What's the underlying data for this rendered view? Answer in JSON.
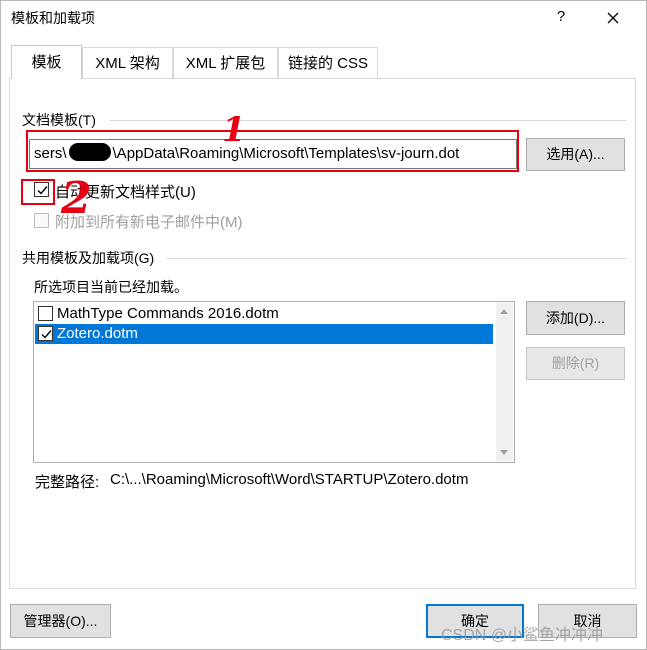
{
  "window": {
    "title": "模板和加载项",
    "help_label": "?"
  },
  "tabs": [
    {
      "label": "模板",
      "active": true
    },
    {
      "label": "XML 架构",
      "active": false
    },
    {
      "label": "XML 扩展包",
      "active": false
    },
    {
      "label": "链接的 CSS",
      "active": false
    }
  ],
  "document_template": {
    "group_label": "文档模板(T)",
    "path_prefix": "sers\\",
    "path_suffix": "\\AppData\\Roaming\\Microsoft\\Templates\\sv-journ.dot",
    "attach_button": "选用(A)...",
    "auto_update": {
      "label": "自动更新文档样式(U)",
      "checked": true
    },
    "attach_email": {
      "label": "附加到所有新电子邮件中(M)",
      "checked": false,
      "disabled": true
    }
  },
  "global_templates": {
    "group_label": "共用模板及加载项(G)",
    "subtitle": "所选项目当前已经加载。",
    "items": [
      {
        "label": "MathType Commands 2016.dotm",
        "checked": false,
        "selected": false
      },
      {
        "label": "Zotero.dotm",
        "checked": true,
        "selected": true
      }
    ],
    "add_button": "添加(D)...",
    "remove_button": "删除(R)",
    "full_path_label": "完整路径:",
    "full_path_value": "C:\\...\\Roaming\\Microsoft\\Word\\STARTUP\\Zotero.dotm"
  },
  "footer": {
    "organizer_button": "管理器(O)...",
    "ok_button": "确定",
    "cancel_button": "取消"
  },
  "annotations": {
    "mark1": "1",
    "mark2": "2",
    "color": "#e60012"
  },
  "watermark": "CSDN @小鲨鱼冲冲冲",
  "colors": {
    "accent": "#0078d7"
  }
}
